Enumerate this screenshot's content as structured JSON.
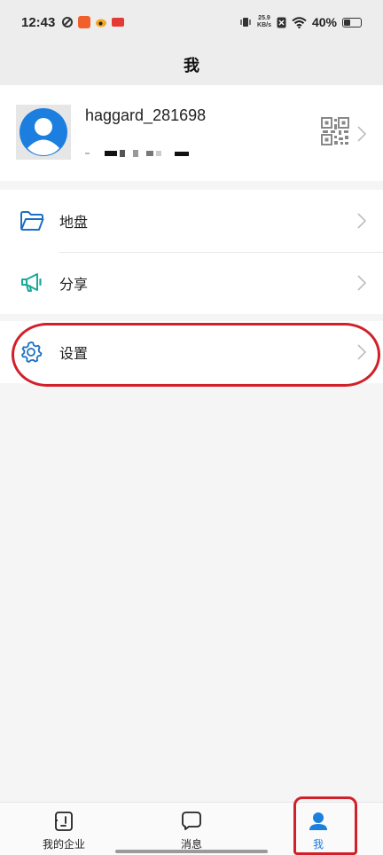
{
  "status_bar": {
    "time": "12:43",
    "net_speed_value": "25.9",
    "net_speed_unit": "KB/s",
    "battery": "40%",
    "battery_level": 0.4
  },
  "header": {
    "title": "我"
  },
  "profile": {
    "username": "haggard_281698"
  },
  "menu": {
    "group1": [
      {
        "label": "地盘",
        "icon": "folder-icon"
      },
      {
        "label": "分享",
        "icon": "megaphone-icon"
      }
    ],
    "group2": [
      {
        "label": "设置",
        "icon": "gear-icon"
      }
    ]
  },
  "bottom_nav": {
    "items": [
      {
        "label": "我的企业",
        "icon": "enterprise-icon",
        "active": false
      },
      {
        "label": "消息",
        "icon": "message-icon",
        "active": false
      },
      {
        "label": "我",
        "icon": "person-icon",
        "active": true
      }
    ]
  },
  "colors": {
    "accent": "#1c7fe0",
    "share_icon": "#1aa99a",
    "annotation": "#d2202a"
  }
}
